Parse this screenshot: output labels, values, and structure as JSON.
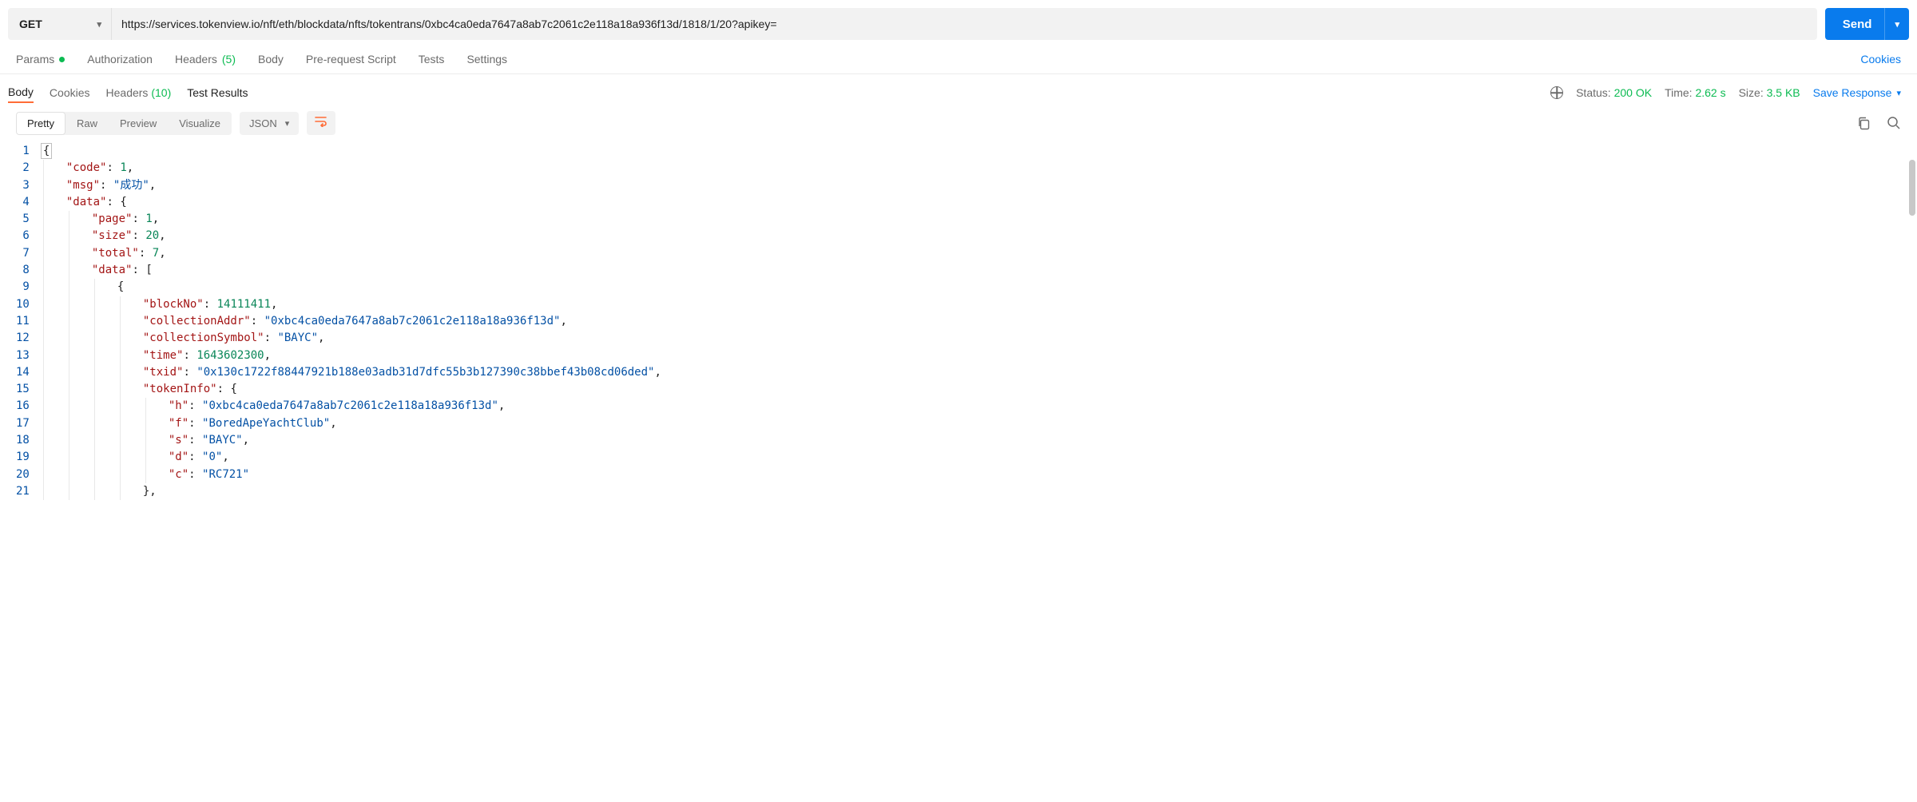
{
  "request": {
    "method": "GET",
    "url": "https://services.tokenview.io/nft/eth/blockdata/nfts/tokentrans/0xbc4ca0eda7647a8ab7c2061c2e118a18a936f13d/1818/1/20?apikey=",
    "send_label": "Send"
  },
  "req_tabs": {
    "params": "Params",
    "authorization": "Authorization",
    "headers": "Headers",
    "headers_count": "(5)",
    "body": "Body",
    "prerequest": "Pre-request Script",
    "tests": "Tests",
    "settings": "Settings",
    "cookies_link": "Cookies"
  },
  "resp_tabs": {
    "body": "Body",
    "cookies": "Cookies",
    "headers": "Headers",
    "headers_count": "(10)",
    "test_results": "Test Results"
  },
  "status": {
    "status_label": "Status:",
    "status_value": "200 OK",
    "time_label": "Time:",
    "time_value": "2.62 s",
    "size_label": "Size:",
    "size_value": "3.5 KB",
    "save_response": "Save Response"
  },
  "view_bar": {
    "pretty": "Pretty",
    "raw": "Raw",
    "preview": "Preview",
    "visualize": "Visualize",
    "format": "JSON"
  },
  "json_lines": [
    {
      "n": 1,
      "indent": 0,
      "raw": true,
      "html": "<span class='line1-box tok-brace'>{</span>"
    },
    {
      "n": 2,
      "indent": 1,
      "key": "code",
      "valType": "num",
      "val": "1",
      "comma": true
    },
    {
      "n": 3,
      "indent": 1,
      "key": "msg",
      "valType": "str",
      "val": "成功",
      "comma": true
    },
    {
      "n": 4,
      "indent": 1,
      "key": "data",
      "open": "{"
    },
    {
      "n": 5,
      "indent": 2,
      "key": "page",
      "valType": "num",
      "val": "1",
      "comma": true
    },
    {
      "n": 6,
      "indent": 2,
      "key": "size",
      "valType": "num",
      "val": "20",
      "comma": true
    },
    {
      "n": 7,
      "indent": 2,
      "key": "total",
      "valType": "num",
      "val": "7",
      "comma": true
    },
    {
      "n": 8,
      "indent": 2,
      "key": "data",
      "open": "["
    },
    {
      "n": 9,
      "indent": 3,
      "open_only": "{"
    },
    {
      "n": 10,
      "indent": 4,
      "key": "blockNo",
      "valType": "num",
      "val": "14111411",
      "comma": true
    },
    {
      "n": 11,
      "indent": 4,
      "key": "collectionAddr",
      "valType": "str",
      "val": "0xbc4ca0eda7647a8ab7c2061c2e118a18a936f13d",
      "comma": true
    },
    {
      "n": 12,
      "indent": 4,
      "key": "collectionSymbol",
      "valType": "str",
      "val": "BAYC",
      "comma": true
    },
    {
      "n": 13,
      "indent": 4,
      "key": "time",
      "valType": "num",
      "val": "1643602300",
      "comma": true
    },
    {
      "n": 14,
      "indent": 4,
      "key": "txid",
      "valType": "str",
      "val": "0x130c1722f88447921b188e03adb31d7dfc55b3b127390c38bbef43b08cd06ded",
      "comma": true
    },
    {
      "n": 15,
      "indent": 4,
      "key": "tokenInfo",
      "open": "{"
    },
    {
      "n": 16,
      "indent": 5,
      "key": "h",
      "valType": "str",
      "val": "0xbc4ca0eda7647a8ab7c2061c2e118a18a936f13d",
      "comma": true
    },
    {
      "n": 17,
      "indent": 5,
      "key": "f",
      "valType": "str",
      "val": "BoredApeYachtClub",
      "comma": true
    },
    {
      "n": 18,
      "indent": 5,
      "key": "s",
      "valType": "str",
      "val": "BAYC",
      "comma": true
    },
    {
      "n": 19,
      "indent": 5,
      "key": "d",
      "valType": "str",
      "val": "0",
      "comma": true
    },
    {
      "n": 20,
      "indent": 5,
      "key": "c",
      "valType": "str",
      "val": "RC721"
    },
    {
      "n": 21,
      "indent": 4,
      "close": "}",
      "comma": true
    }
  ]
}
